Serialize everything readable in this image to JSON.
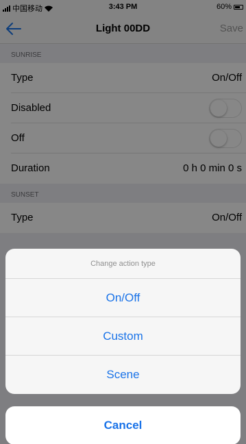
{
  "status_bar": {
    "carrier": "中国移动",
    "time": "3:43 PM",
    "battery": "60%"
  },
  "nav": {
    "title": "Light 00DD",
    "save_label": "Save"
  },
  "sunrise": {
    "header": "SUNRISE",
    "rows": [
      {
        "label": "Type",
        "value": "On/Off"
      },
      {
        "label": "Disabled",
        "toggle_on": false
      },
      {
        "label": "Off",
        "toggle_on": false
      },
      {
        "label": "Duration",
        "value": "0 h 0 min 0 s"
      }
    ]
  },
  "sunset": {
    "header": "SUNSET",
    "rows": [
      {
        "label": "Type",
        "value": "On/Off"
      }
    ]
  },
  "action_sheet": {
    "title": "Change action type",
    "options": [
      "On/Off",
      "Custom",
      "Scene"
    ],
    "cancel_label": "Cancel"
  },
  "colors": {
    "accent": "#1a73e8",
    "nav_bar": "#f7f7f7",
    "grouped_background": "#efeff4"
  },
  "icons": {
    "back": "arrow-left-icon",
    "signal": "cellular-signal-icon",
    "wifi": "wifi-icon",
    "battery": "battery-icon"
  }
}
